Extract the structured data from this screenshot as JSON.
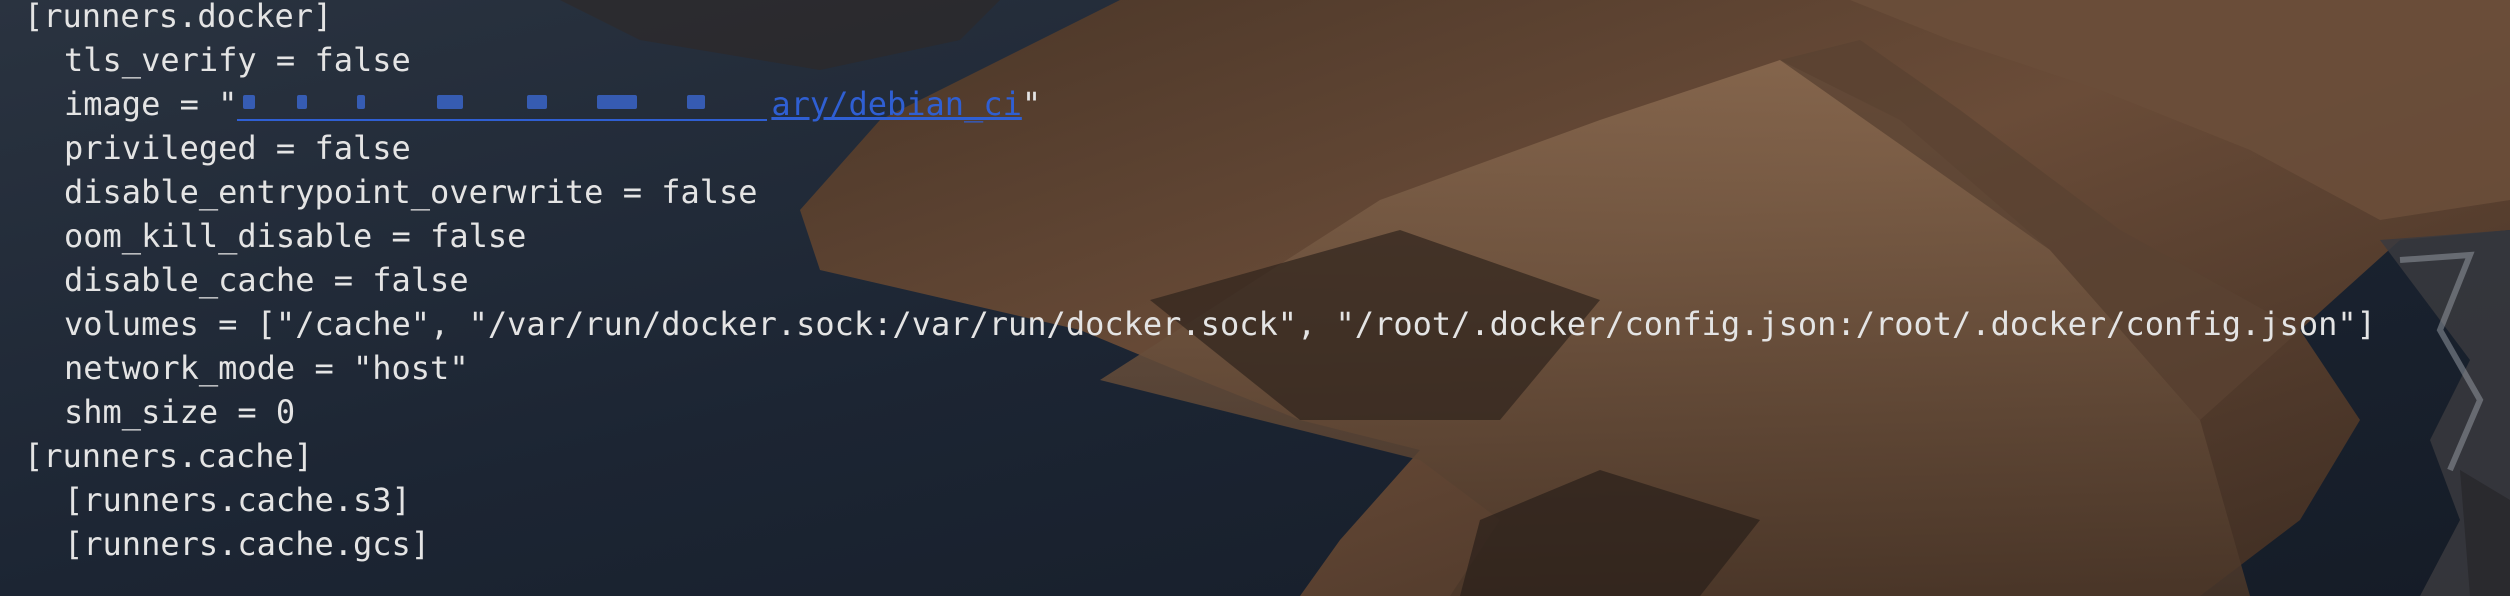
{
  "background": {
    "description_icon": "coastal-hills-wallpaper-icon",
    "colors": {
      "sea": "#1c2533",
      "land_dark": "#3a2a20",
      "land_light": "#7a5a42",
      "foam": "#8a9098"
    }
  },
  "terminal": {
    "text_color": "#e4e4e4",
    "link_color": "#2f5fd3",
    "lines": {
      "l0": "[runners.docker]",
      "l1": "tls_verify = false",
      "l2_prefix": "image = \"",
      "l2_link_tail": "ary/debian_ci",
      "l2_suffix": "\"",
      "l3": "privileged = false",
      "l4": "disable_entrypoint_overwrite = false",
      "l5": "oom_kill_disable = false",
      "l6": "disable_cache = false",
      "l7": "volumes = [\"/cache\", \"/var/run/docker.sock:/var/run/docker.sock\", \"/root/.docker/config.json:/root/.docker/config.json\"]",
      "l8": "network_mode = \"host\"",
      "l9": "shm_size = 0",
      "l10": "[runners.cache]",
      "l11": "[runners.cache.s3]",
      "l12": "[runners.cache.gcs]"
    }
  }
}
